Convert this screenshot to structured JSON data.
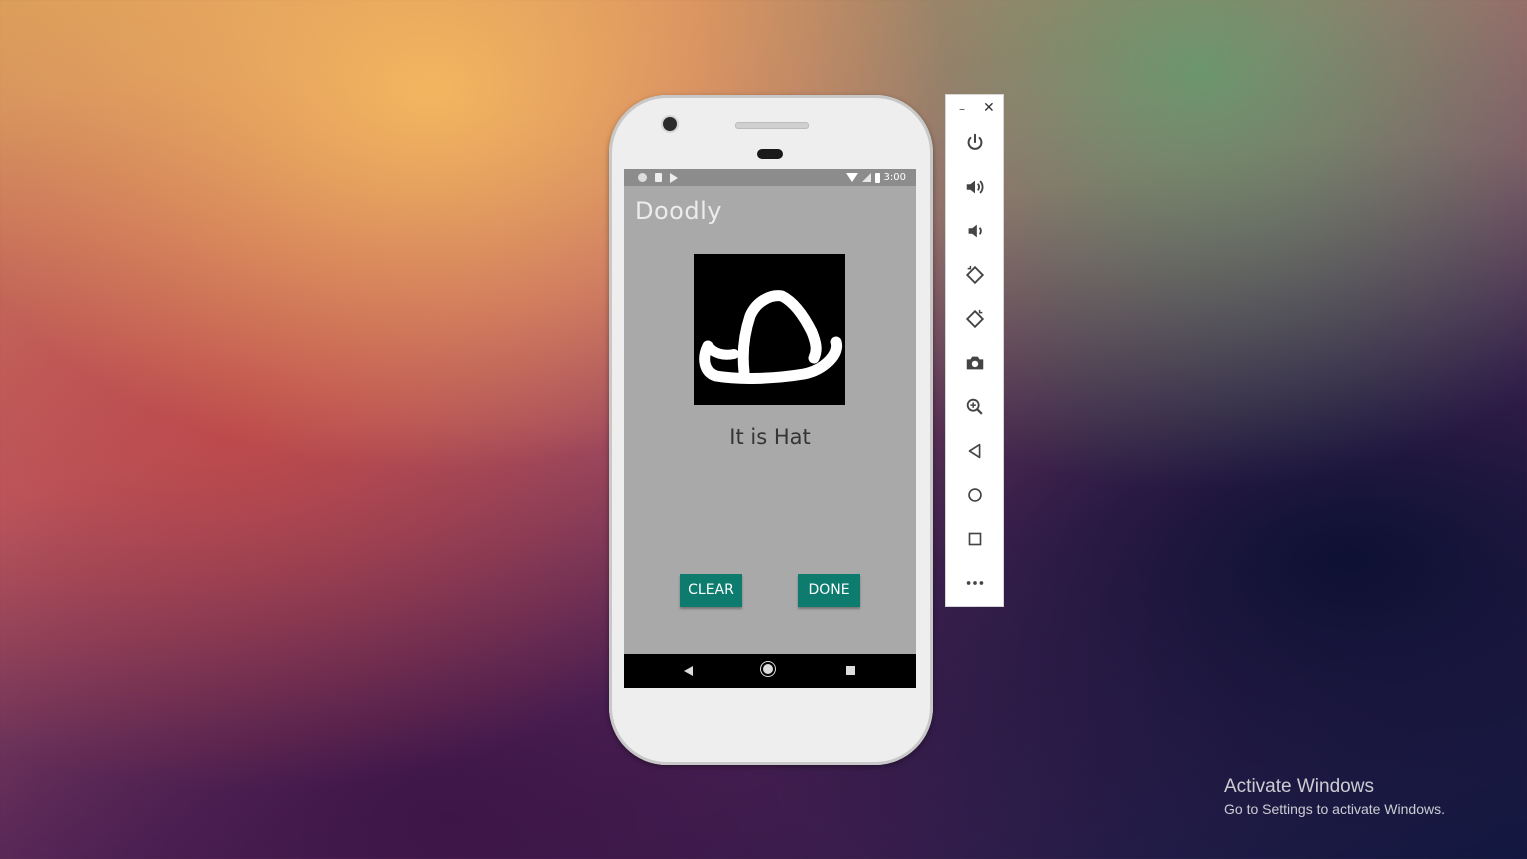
{
  "status_bar": {
    "time": "3:00"
  },
  "app": {
    "title": "Doodly",
    "result_text": "It is Hat",
    "clear_label": "CLEAR",
    "done_label": "DONE",
    "button_color": "#0d7c6f",
    "canvas_color": "#000000"
  },
  "emulator_toolbar": {
    "minimize_glyph": "–",
    "close_glyph": "✕",
    "icons": [
      "power-icon",
      "volume-up-icon",
      "volume-down-icon",
      "rotate-left-icon",
      "rotate-right-icon",
      "camera-icon",
      "zoom-icon",
      "back-icon",
      "home-icon",
      "overview-icon",
      "more-icon"
    ]
  },
  "watermark": {
    "title": "Activate Windows",
    "subtitle": "Go to Settings to activate Windows."
  }
}
